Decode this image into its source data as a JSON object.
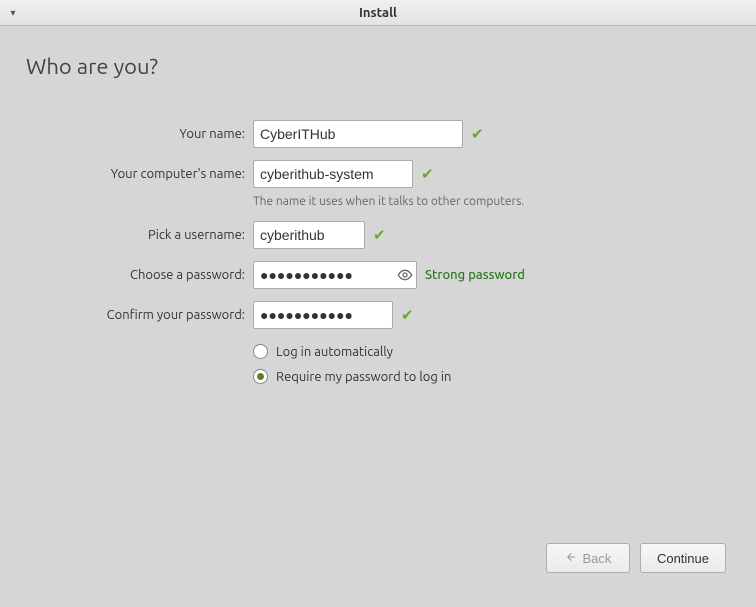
{
  "titlebar": {
    "title": "Install"
  },
  "heading": "Who are you?",
  "fields": {
    "name": {
      "label": "Your name:",
      "value": "CyberITHub"
    },
    "computer": {
      "label": "Your computer's name:",
      "value": "cyberithub-system",
      "helper": "The name it uses when it talks to other computers."
    },
    "username": {
      "label": "Pick a username:",
      "value": "cyberithub"
    },
    "password": {
      "label": "Choose a password:",
      "value": "●●●●●●●●●●●",
      "strength": "Strong password"
    },
    "confirm": {
      "label": "Confirm your password:",
      "value": "●●●●●●●●●●●"
    }
  },
  "options": {
    "auto_login": "Log in automatically",
    "require_password": "Require my password to log in"
  },
  "footer": {
    "back": "Back",
    "continue": "Continue"
  }
}
